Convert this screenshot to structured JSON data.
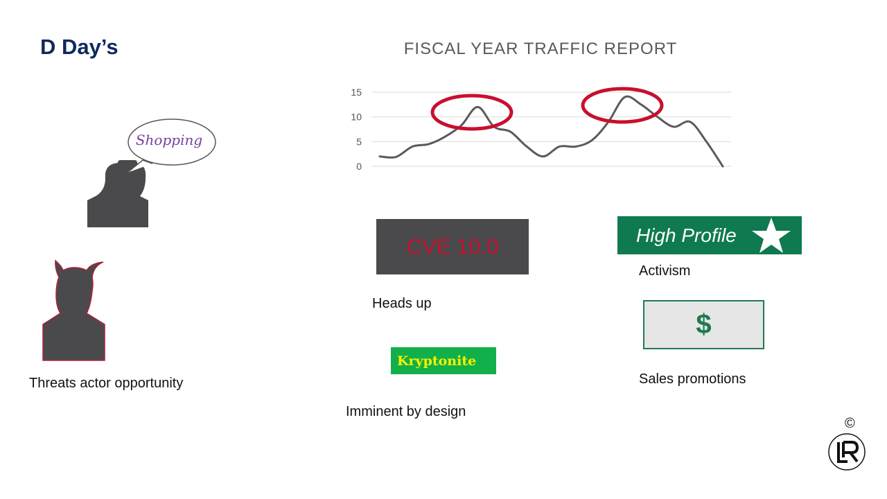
{
  "slide": {
    "title": "D Day’s",
    "copyright": "©"
  },
  "shopper": {
    "speech": "Shopping",
    "speech_color": "#7a3e9d"
  },
  "threat": {
    "caption": "Threats actor opportunity"
  },
  "cards": {
    "cve": {
      "label": "CVE 10.0",
      "caption": "Heads up"
    },
    "high_profile": {
      "label": "High Profile",
      "caption": "Activism"
    },
    "kryptonite": {
      "label": "Kryptonite",
      "caption": "Imminent by design"
    },
    "dollar": {
      "label": "$",
      "caption": "Sales promotions"
    }
  },
  "colors": {
    "title": "#0e2a5c",
    "silhouette": "#4a4a4d",
    "highlight_ring": "#c8102e",
    "high_profile_bg": "#0f7a4f",
    "kryptonite_bg": "#11b04a",
    "kryptonite_text": "#f6f200"
  },
  "chart_data": {
    "type": "line",
    "title": "FISCAL YEAR TRAFFIC REPORT",
    "xlabel": "",
    "ylabel": "",
    "ylim": [
      0,
      15
    ],
    "yticks": [
      "15",
      "10",
      "5",
      "0"
    ],
    "grid": true,
    "x": [
      0,
      1,
      2,
      3,
      4,
      5,
      6,
      7,
      8,
      9,
      10,
      11,
      12,
      13,
      14,
      15,
      16,
      17,
      18,
      19,
      20,
      21,
      22,
      23,
      24,
      25,
      26,
      27,
      28
    ],
    "series": [
      {
        "values": [
          2,
          1.9,
          4,
          4.5,
          6,
          8.3,
          12,
          8,
          7,
          4,
          2,
          4,
          4,
          5.3,
          9,
          14,
          12.5,
          10,
          8,
          9,
          5,
          0
        ]
      }
    ],
    "highlights": [
      "peak-1",
      "peak-2"
    ]
  }
}
